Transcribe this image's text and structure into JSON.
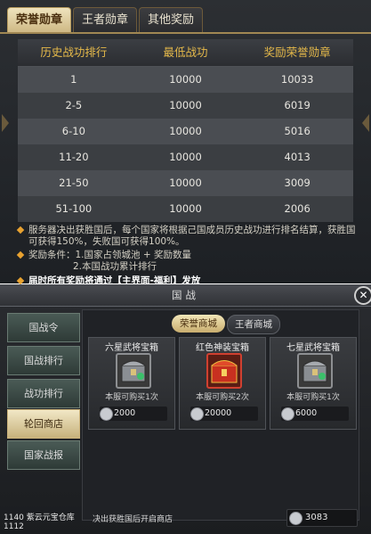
{
  "top": {
    "tabs": [
      "荣誉勋章",
      "王者勋章",
      "其他奖励"
    ],
    "headers": [
      "历史战功排行",
      "最低战功",
      "奖励荣誉勋章"
    ],
    "rows": [
      [
        "1",
        "10000",
        "10033"
      ],
      [
        "2-5",
        "10000",
        "6019"
      ],
      [
        "6-10",
        "10000",
        "5016"
      ],
      [
        "11-20",
        "10000",
        "4013"
      ],
      [
        "21-50",
        "10000",
        "3009"
      ],
      [
        "51-100",
        "10000",
        "2006"
      ]
    ],
    "notes": {
      "n1": "服务器决出获胜国后，每个国家将根据己国成员历史战功进行排名结算，获胜国可获得150%，失败国可获得100%。",
      "n2a": "奖励条件：1.国家占领城池 + 奖励数量",
      "n2b": "2.本国战功累计排行",
      "n3a": "届时所有奖励将通过",
      "n3hl": "【主界面-福利】",
      "n3b": "发放"
    }
  },
  "bottom": {
    "title": "国战",
    "close_label": "✕",
    "sidebar": [
      "国战令",
      "国战排行",
      "战功排行",
      "轮回商店",
      "国家战报"
    ],
    "shop_tabs": [
      "荣誉商城",
      "王者商城"
    ],
    "cards": [
      {
        "title": "六星武将宝箱",
        "limit": "本服可购买1次",
        "price": "2000",
        "icon": "silver-chest-icon"
      },
      {
        "title": "红色神装宝箱",
        "limit": "本服可购买2次",
        "price": "20000",
        "icon": "red-chest-icon"
      },
      {
        "title": "七星武将宝箱",
        "limit": "本服可购买1次",
        "price": "6000",
        "icon": "silver-chest-icon"
      }
    ],
    "footer_hint": "决出获胜国后开启商店",
    "footer_amount": "3083",
    "overlay_a": "1140",
    "overlay_b": "紫云元宝仓库",
    "overlay_c": "1112"
  },
  "colors": {
    "gold": "#e5b94a",
    "accent_orange": "#e8a230",
    "highlight": "#e46a2b"
  }
}
